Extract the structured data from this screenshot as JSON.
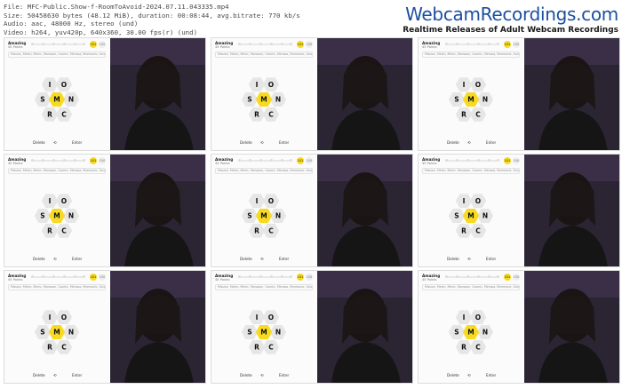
{
  "info": {
    "file": "File: MFC-Public.Show-f-RoomToAvoid-2024.07.11.043335.mp4",
    "size": "Size: 50458630 bytes (48.12 MiB), duration: 00:08:44, avg.bitrate: 770 kb/s",
    "audio": "Audio: aac, 48000 Hz, stereo (und)",
    "video": "Video: h264, yuv420p, 640x360, 30.00 fps(r) (und)"
  },
  "brand": {
    "title": "WebcamRecordings.com",
    "subtitle": "Realtime Releases of Adult Webcam Recordings"
  },
  "game": {
    "rank": "Amazing",
    "points": "45 Points",
    "found_words": "Mission, Minim, Mimic, Monsoon, Cosmic, Mimosa, Mnemonic, Scion",
    "badge_main": "101",
    "badge_alt": "150",
    "center_letter": "M",
    "outer_letters": [
      "I",
      "O",
      "N",
      "C",
      "R",
      "S"
    ],
    "delete_label": "Delete",
    "shuffle_icon": "shuffle-icon",
    "enter_label": "Enter"
  },
  "frames": [
    {
      "id": 1
    },
    {
      "id": 2
    },
    {
      "id": 3
    },
    {
      "id": 4
    },
    {
      "id": 5
    },
    {
      "id": 6
    },
    {
      "id": 7
    },
    {
      "id": 8
    },
    {
      "id": 9
    }
  ],
  "colors": {
    "center_hex": "#f7da21",
    "outer_hex": "#e6e6e6",
    "brand_blue": "#1b4fa0",
    "backdrop": "#2a2433"
  }
}
